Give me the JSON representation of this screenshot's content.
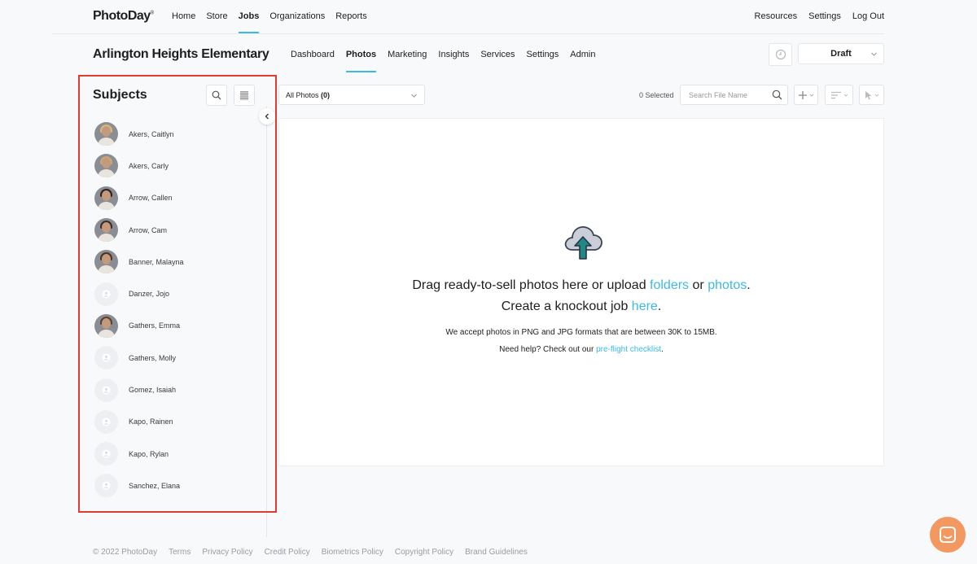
{
  "brand": {
    "name": "PhotoDay",
    "mark": "®"
  },
  "main_nav": [
    "Home",
    "Store",
    "Jobs",
    "Organizations",
    "Reports"
  ],
  "main_nav_active": "Jobs",
  "right_nav": [
    "Resources",
    "Settings",
    "Log Out"
  ],
  "job": {
    "title": "Arlington Heights Elementary",
    "tabs": [
      "Dashboard",
      "Photos",
      "Marketing",
      "Insights",
      "Services",
      "Settings",
      "Admin"
    ],
    "active_tab": "Photos",
    "status": "Draft"
  },
  "sidebar": {
    "title": "Subjects",
    "highlight_color": "#e13b34",
    "subjects": [
      {
        "name": "Akers, Caitlyn",
        "photo": true,
        "hair": "#d9b878"
      },
      {
        "name": "Akers, Carly",
        "photo": true,
        "hair": "#c9a873"
      },
      {
        "name": "Arrow, Callen",
        "photo": true,
        "hair": "#2a221c"
      },
      {
        "name": "Arrow, Cam",
        "photo": true,
        "hair": "#3a2e24"
      },
      {
        "name": "Banner, Malayna",
        "photo": true,
        "hair": "#4a3426"
      },
      {
        "name": "Danzer, Jojo",
        "photo": false
      },
      {
        "name": "Gathers, Emma",
        "photo": true,
        "hair": "#5a4030"
      },
      {
        "name": "Gathers, Molly",
        "photo": false
      },
      {
        "name": "Gomez, Isaiah",
        "photo": false
      },
      {
        "name": "Kapo, Rainen",
        "photo": false
      },
      {
        "name": "Kapo, Rylan",
        "photo": false
      },
      {
        "name": "Sanchez, Elana",
        "photo": false
      }
    ]
  },
  "toolbar": {
    "filter_label": "All Photos",
    "filter_count": "(0)",
    "selected": "0 Selected",
    "search_placeholder": "Search File Name"
  },
  "dropzone": {
    "line1_pre": "Drag ready-to-sell photos here or upload ",
    "line1_link1": "folders",
    "line1_mid": " or ",
    "line1_link2": "photos",
    "line1_post": ".",
    "line2_pre": "Create a knockout job ",
    "line2_link": "here",
    "line2_post": ".",
    "line3": "We accept photos in PNG and JPG formats that are between 30K to 15MB.",
    "line4_pre": "Need help? Check out our ",
    "line4_link": "pre-flight checklist",
    "line4_post": "."
  },
  "footer": [
    "© 2022 PhotoDay",
    "Terms",
    "Privacy Policy",
    "Credit Policy",
    "Biometrics Policy",
    "Copyright Policy",
    "Brand Guidelines"
  ],
  "colors": {
    "accent": "#3eb8e6",
    "chat": "#f29860",
    "upload_arrow": "#1f8a85"
  }
}
